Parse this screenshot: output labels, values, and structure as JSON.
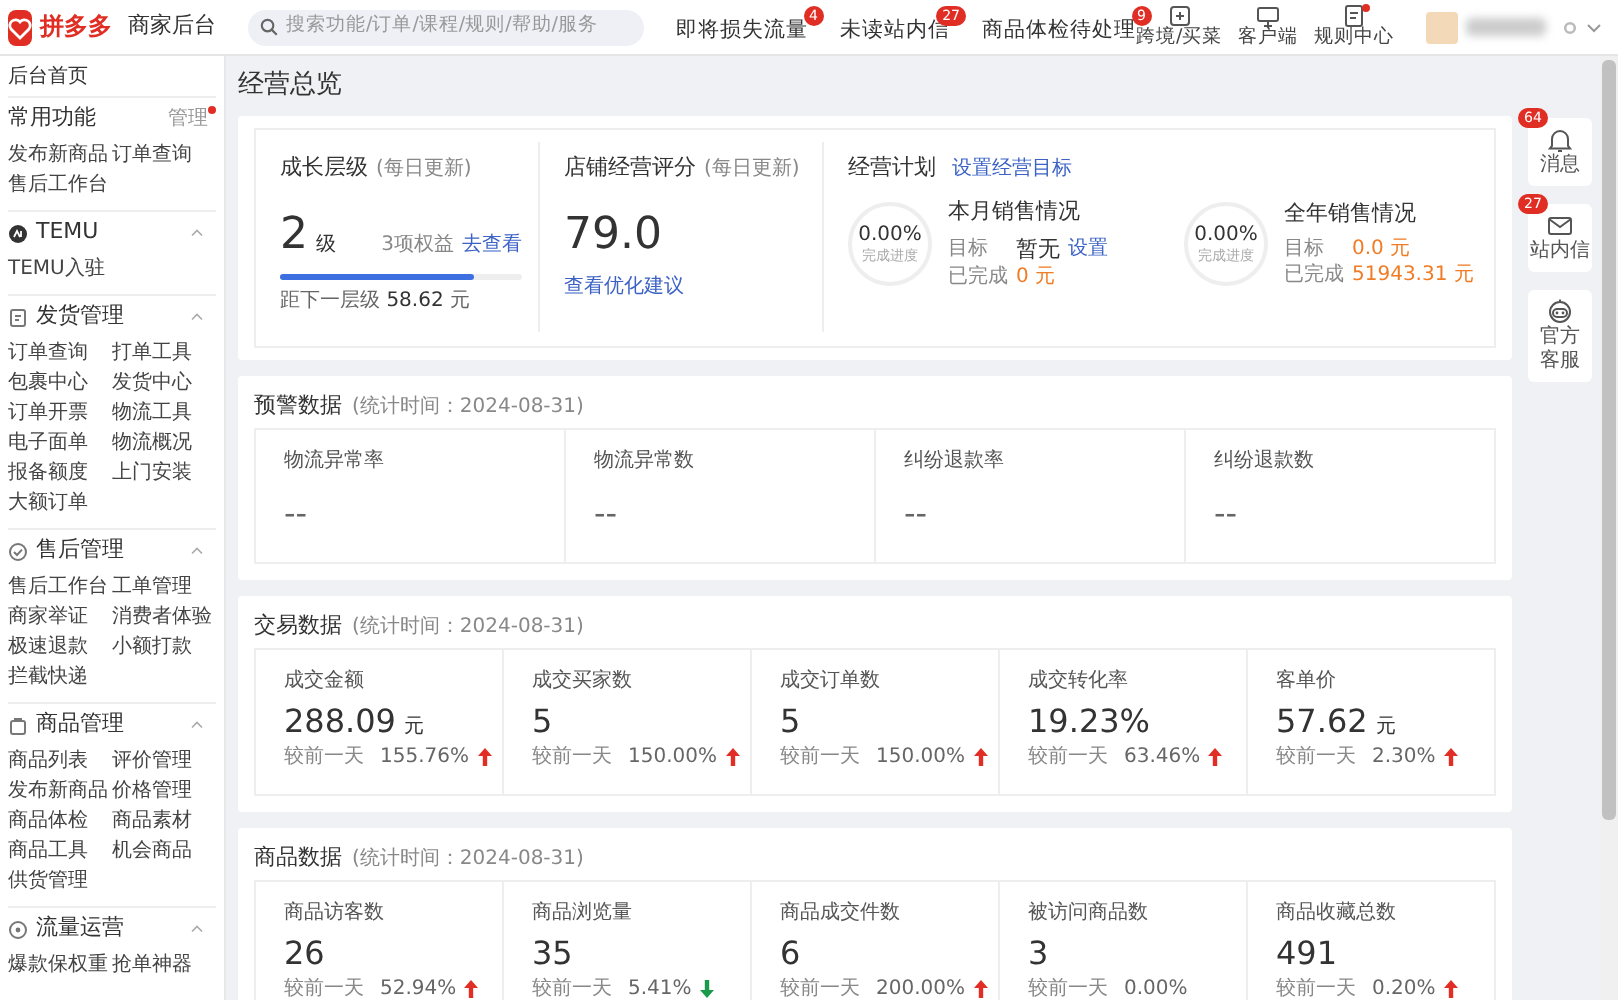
{
  "topbar": {
    "logo_text": "拼多多",
    "app_name": "商家后台",
    "search": {
      "placeholder": "搜索功能/订单/课程/规则/帮助/服务"
    },
    "alerts": [
      {
        "label": "即将损失流量",
        "badge": "4"
      },
      {
        "label": "未读站内信",
        "badge": "27"
      },
      {
        "label": "商品体检待处理",
        "badge": "9"
      }
    ],
    "tools": [
      {
        "label": "跨境/买菜",
        "dot": false
      },
      {
        "label": "客户端",
        "dot": false
      },
      {
        "label": "规则中心",
        "dot": true
      }
    ]
  },
  "sidebar": {
    "home": "后台首页",
    "sections": [
      {
        "title": "常用功能",
        "action": "管理",
        "action_dot": true,
        "items": [
          "发布新商品",
          "订单查询",
          "售后工作台"
        ]
      },
      {
        "title": "TEMU",
        "expanded": true,
        "items": [
          "TEMU入驻"
        ]
      },
      {
        "title": "发货管理",
        "expanded": true,
        "items": [
          "订单查询",
          "打单工具",
          "包裹中心",
          "发货中心",
          "订单开票",
          "物流工具",
          "电子面单",
          "物流概况",
          "报备额度",
          "上门安装",
          "大额订单"
        ]
      },
      {
        "title": "售后管理",
        "expanded": true,
        "items": [
          "售后工作台",
          "工单管理",
          "商家举证",
          "消费者体验",
          "极速退款",
          "小额打款",
          "拦截快递"
        ]
      },
      {
        "title": "商品管理",
        "expanded": true,
        "items": [
          "商品列表",
          "评价管理",
          "发布新商品",
          "价格管理",
          "商品体检",
          "商品素材",
          "商品工具",
          "机会商品",
          "供货管理"
        ]
      },
      {
        "title": "流量运营",
        "expanded": true,
        "items": [
          "爆款保权重",
          "抢单神器"
        ]
      }
    ]
  },
  "overview": {
    "title": "经营总览",
    "growth": {
      "title": "成长层级",
      "note": "(每日更新)",
      "value": "2",
      "unit": "级",
      "rights": "3项权益",
      "link": "去查看",
      "level": 0.8,
      "next_label": "距下一层级",
      "next_value": "58.62",
      "next_unit": "元"
    },
    "score": {
      "title": "店铺经营评分",
      "note": "(每日更新)",
      "value": "79.0",
      "link": "查看优化建议"
    },
    "plan": {
      "title": "经营计划",
      "link": "设置经营目标",
      "blocks": [
        {
          "title": "本月销售情况",
          "ring_value": "0.00%",
          "ring_label": "完成进度",
          "target_label": "目标",
          "target": "暂无",
          "target_highlight": false,
          "target_link": "设置",
          "done_label": "已完成",
          "done": "0",
          "done_unit": "元"
        },
        {
          "title": "全年销售情况",
          "ring_value": "0.00%",
          "ring_label": "完成进度",
          "target_label": "目标",
          "target": "0.0",
          "target_highlight": true,
          "target_unit": "元",
          "done_label": "已完成",
          "done": "51943.31",
          "done_unit": "元"
        }
      ]
    }
  },
  "warning": {
    "title": "预警数据",
    "note": "(统计时间：2024-08-31)",
    "metrics": [
      {
        "label": "物流异常率",
        "value": "--"
      },
      {
        "label": "物流异常数",
        "value": "--"
      },
      {
        "label": "纠纷退款率",
        "value": "--"
      },
      {
        "label": "纠纷退款数",
        "value": "--"
      }
    ]
  },
  "transaction": {
    "title": "交易数据",
    "note": "(统计时间：2024-08-31)",
    "metrics": [
      {
        "label": "成交金额",
        "value": "288.09",
        "unit": "元",
        "compare_label": "较前一天",
        "change": "155.76%",
        "kind": "rise"
      },
      {
        "label": "成交买家数",
        "value": "5",
        "compare_label": "较前一天",
        "change": "150.00%",
        "kind": "rise"
      },
      {
        "label": "成交订单数",
        "value": "5",
        "compare_label": "较前一天",
        "change": "150.00%",
        "kind": "rise"
      },
      {
        "label": "成交转化率",
        "value": "19.23%",
        "compare_label": "较前一天",
        "change": "63.46%",
        "kind": "rise"
      },
      {
        "label": "客单价",
        "value": "57.62",
        "unit": "元",
        "compare_label": "较前一天",
        "change": "2.30%",
        "kind": "rise"
      }
    ]
  },
  "product": {
    "title": "商品数据",
    "note": "(统计时间：2024-08-31)",
    "metrics": [
      {
        "label": "商品访客数",
        "value": "26",
        "compare_label": "较前一天",
        "change": "52.94%",
        "kind": "rise"
      },
      {
        "label": "商品浏览量",
        "value": "35",
        "compare_label": "较前一天",
        "change": "5.41%",
        "kind": "fall"
      },
      {
        "label": "商品成交件数",
        "value": "6",
        "compare_label": "较前一天",
        "change": "200.00%",
        "kind": "rise"
      },
      {
        "label": "被访问商品数",
        "value": "3",
        "compare_label": "较前一天",
        "change": "0.00%",
        "kind": "flat"
      },
      {
        "label": "商品收藏总数",
        "value": "491",
        "compare_label": "较前一天",
        "change": "0.20%",
        "kind": "rise"
      }
    ]
  },
  "rail": [
    {
      "label": "消息",
      "badge": "64"
    },
    {
      "label": "站内信",
      "badge": "27"
    },
    {
      "label": "官方客服"
    }
  ]
}
